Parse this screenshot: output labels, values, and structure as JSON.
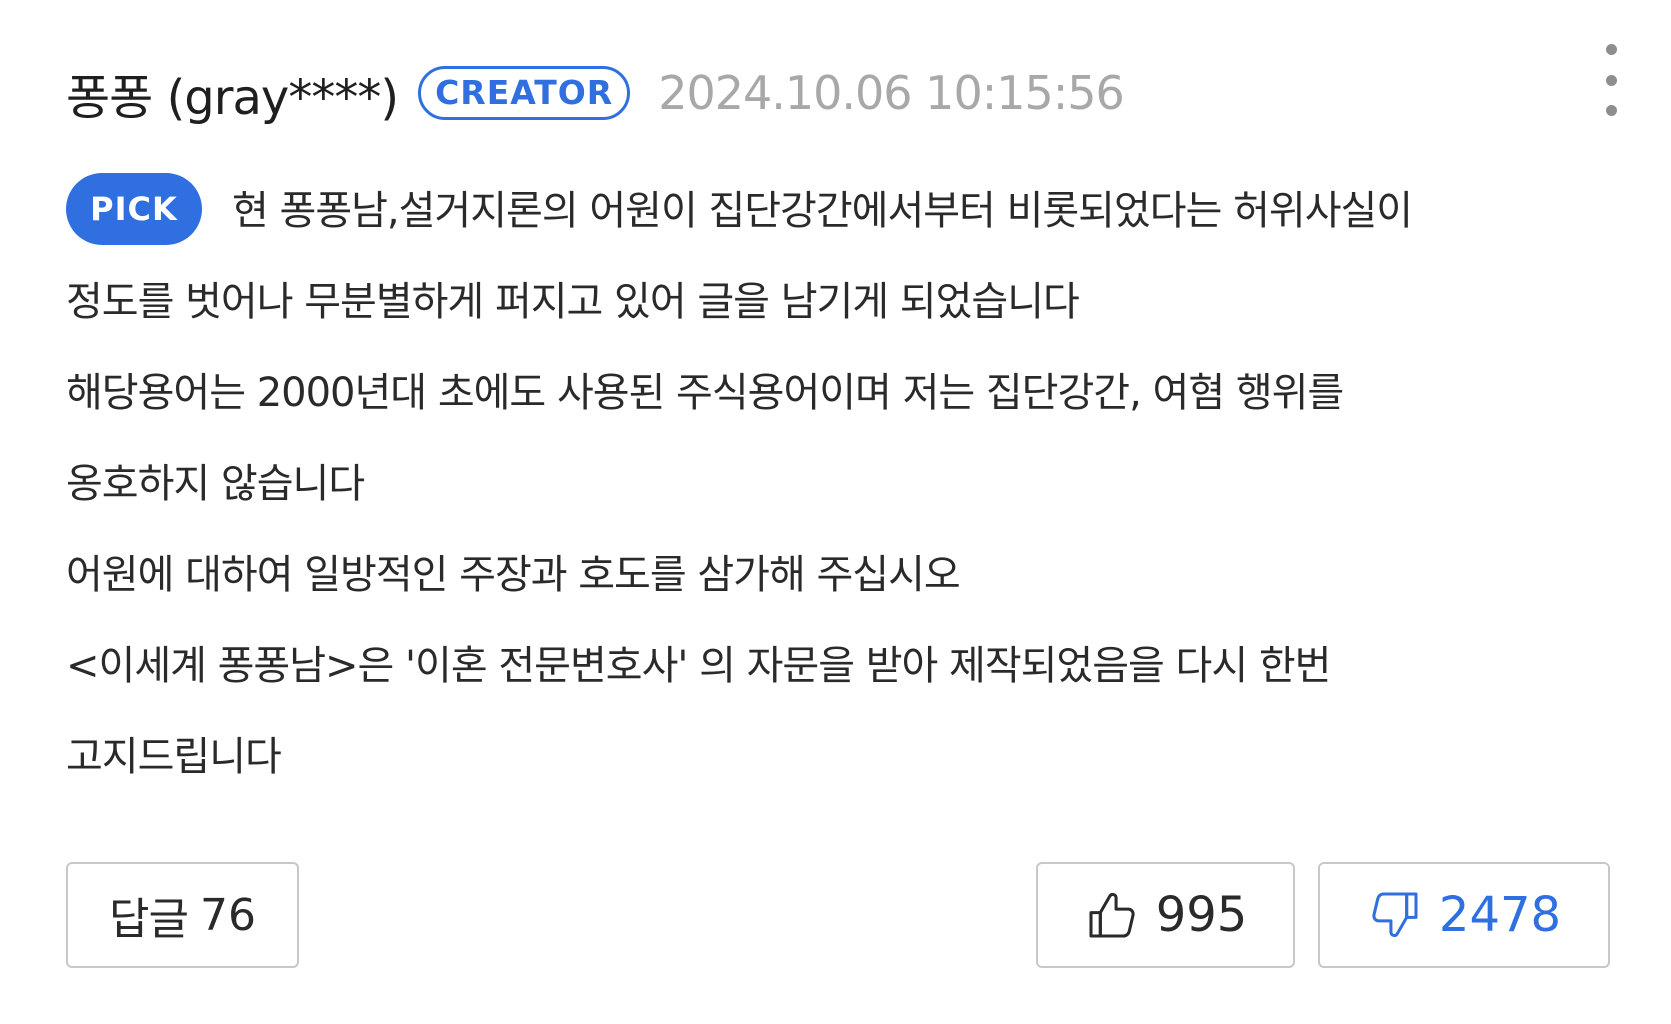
{
  "comment": {
    "author": "퐁퐁 (gray****)",
    "badge": "CREATOR",
    "timestamp": "2024.10.06 10:15:56",
    "pick_label": "PICK",
    "lines": [
      "현 퐁퐁남,설거지론의 어원이 집단강간에서부터 비롯되었다는 허위사실이",
      "정도를 벗어나 무분별하게 퍼지고 있어 글을 남기게 되었습니다",
      "해당용어는 2000년대 초에도 사용된 주식용어이며 저는 집단강간, 여혐 행위를",
      "옹호하지 않습니다",
      "어원에 대하여 일방적인 주장과 호도를 삼가해 주십시오",
      "<이세계 퐁퐁남>은 '이혼 전문변호사' 의 자문을 받아 제작되었음을 다시 한번",
      "고지드립니다"
    ],
    "reply_label": "답글",
    "reply_count": "76",
    "like_count": "995",
    "dislike_count": "2478"
  },
  "icons": {
    "more": "more-vertical-icon",
    "like": "thumbs-up-icon",
    "dislike": "thumbs-down-icon"
  },
  "colors": {
    "accent": "#2f6fe0",
    "timestamp": "#a8a8a8",
    "border": "#c8c8c8",
    "text": "#2a2a2a"
  }
}
